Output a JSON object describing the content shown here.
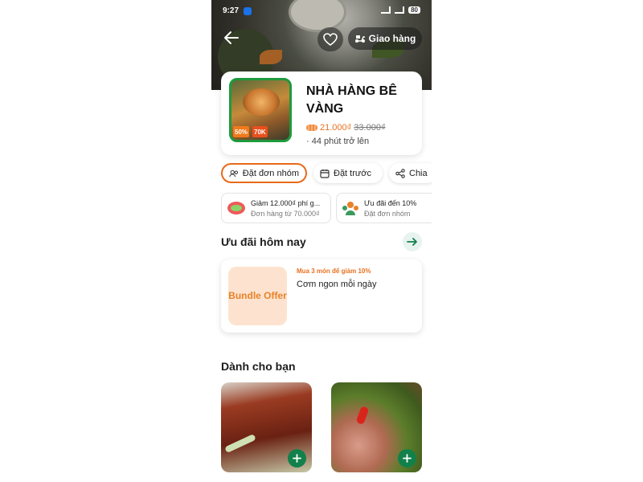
{
  "status_bar": {
    "time": "9:27",
    "battery": "80"
  },
  "header": {
    "delivery_label": "Giao hàng"
  },
  "restaurant": {
    "name": "NHÀ HÀNG BÊ VÀNG",
    "thumb_tag_discount": "50%",
    "thumb_tag_amount": "70K",
    "delivery_fee": "21.000₫",
    "original_fee": "33.000₫",
    "eta": "· 44 phút trở lên"
  },
  "actions": {
    "group_order": "Đặt đơn nhóm",
    "preorder": "Đặt trước",
    "share": "Chia"
  },
  "promos": [
    {
      "title": "Giảm 12.000₫ phí g...",
      "subtitle": "Đơn hàng từ 70.000₫"
    },
    {
      "title": "Ưu đãi đến 10%",
      "subtitle": "Đặt đơn nhóm"
    }
  ],
  "today_offers": {
    "title": "Ưu đãi hôm nay",
    "bundle_image_text": "Bundle Offer",
    "bundle_promo": "Mua 3 món để giảm 10%",
    "bundle_name": "Cơm ngon mỗi ngày"
  },
  "for_you": {
    "title": "Dành cho bạn"
  },
  "icons": {
    "back": "arrow-left-icon",
    "favorite": "heart-icon",
    "delivery": "scooter-icon",
    "group": "group-icon",
    "calendar": "calendar-icon",
    "share": "share-icon",
    "arrow_right": "arrow-right-icon",
    "add": "plus-icon"
  },
  "colors": {
    "accent_orange": "#e86a1a",
    "brand_green": "#12804a",
    "thumb_border": "#1e9a3d"
  }
}
